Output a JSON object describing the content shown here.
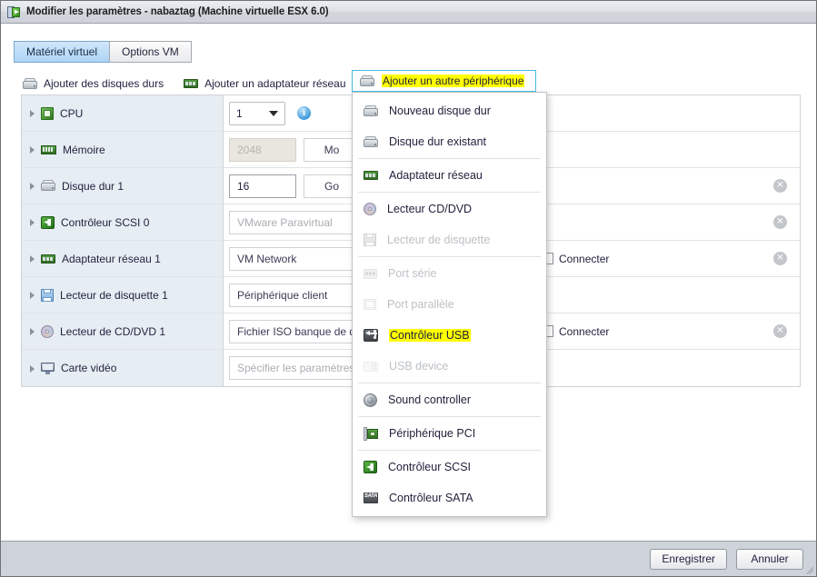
{
  "window": {
    "title": "Modifier les paramètres - nabaztag (Machine virtuelle ESX 6.0)",
    "icon": "vm-settings-icon"
  },
  "tabs": [
    {
      "label": "Matériel virtuel",
      "active": true
    },
    {
      "label": "Options VM",
      "active": false
    }
  ],
  "toolbar": {
    "add_disks": {
      "label": "Ajouter des disques durs",
      "icon": "hard-disk-icon"
    },
    "add_nic": {
      "label": "Ajouter un adaptateur réseau",
      "icon": "network-adapter-icon"
    },
    "add_other": {
      "label": "Ajouter un autre périphérique",
      "icon": "other-device-icon",
      "highlighted": true
    }
  },
  "devices": [
    {
      "name": "CPU",
      "icon": "cpu-icon",
      "control": "select",
      "value": "1",
      "info_icon": "info-icon",
      "removable": false
    },
    {
      "name": "Mémoire",
      "icon": "memory-icon",
      "control": "number-unit",
      "value": "2048",
      "unit": "Mo",
      "disabled": true,
      "removable": false
    },
    {
      "name": "Disque dur 1",
      "icon": "hard-disk-icon",
      "control": "number-unit",
      "value": "16",
      "unit": "Go",
      "disabled": false,
      "removable": true
    },
    {
      "name": "Contrôleur SCSI 0",
      "icon": "scsi-controller-icon",
      "control": "text",
      "value": "VMware Paravirtual",
      "placeholder_style": true,
      "removable": true
    },
    {
      "name": "Adaptateur réseau 1",
      "icon": "network-adapter-icon",
      "control": "text",
      "value": "VM Network",
      "connect_label": "Connecter",
      "removable": true
    },
    {
      "name": "Lecteur de disquette 1",
      "icon": "floppy-drive-icon",
      "control": "text",
      "value": "Périphérique client",
      "removable": false
    },
    {
      "name": "Lecteur de CD/DVD 1",
      "icon": "cd-dvd-icon",
      "control": "text",
      "value": "Fichier ISO banque de données",
      "connect_label": "Connecter",
      "removable": true
    },
    {
      "name": "Carte vidéo",
      "icon": "video-card-icon",
      "control": "text",
      "value": "Spécifier les paramètres personnalisés",
      "placeholder_style": true,
      "removable": false
    }
  ],
  "menu": {
    "items": [
      {
        "label": "Nouveau disque dur",
        "icon": "hard-disk-icon",
        "disabled": false,
        "highlighted": false
      },
      {
        "label": "Disque dur existant",
        "icon": "hard-disk-icon",
        "disabled": false,
        "highlighted": false
      },
      {
        "separator_after": true
      },
      {
        "label": "Adaptateur réseau",
        "icon": "network-adapter-icon",
        "disabled": false,
        "highlighted": false
      },
      {
        "separator_after": true
      },
      {
        "label": "Lecteur CD/DVD",
        "icon": "cd-dvd-icon",
        "disabled": false,
        "highlighted": false
      },
      {
        "label": "Lecteur de disquette",
        "icon": "floppy-drive-icon",
        "disabled": true,
        "highlighted": false
      },
      {
        "separator_after": true
      },
      {
        "label": "Port série",
        "icon": "serial-port-icon",
        "disabled": true,
        "highlighted": false
      },
      {
        "label": "Port parallèle",
        "icon": "parallel-port-icon",
        "disabled": true,
        "highlighted": false
      },
      {
        "label": "Contrôleur USB",
        "icon": "usb-controller-icon",
        "disabled": false,
        "highlighted": true
      },
      {
        "label": "USB device",
        "icon": "usb-device-icon",
        "disabled": true,
        "highlighted": false
      },
      {
        "separator_after": true
      },
      {
        "label": "Sound controller",
        "icon": "sound-controller-icon",
        "disabled": false,
        "highlighted": false
      },
      {
        "separator_after": true
      },
      {
        "label": "Périphérique PCI",
        "icon": "pci-device-icon",
        "disabled": false,
        "highlighted": false
      },
      {
        "separator_after": true
      },
      {
        "label": "Contrôleur SCSI",
        "icon": "scsi-controller-icon",
        "disabled": false,
        "highlighted": false
      },
      {
        "label": "Contrôleur SATA",
        "icon": "sata-controller-icon",
        "disabled": false,
        "highlighted": false
      }
    ]
  },
  "footer": {
    "save_label": "Enregistrer",
    "cancel_label": "Annuler"
  },
  "colors": {
    "highlight": "#ffff00",
    "focus_border": "#45b8e0",
    "name_column_bg": "#e6edf3",
    "active_tab": "#aed5f6",
    "footer_bg": "#ced3da"
  }
}
